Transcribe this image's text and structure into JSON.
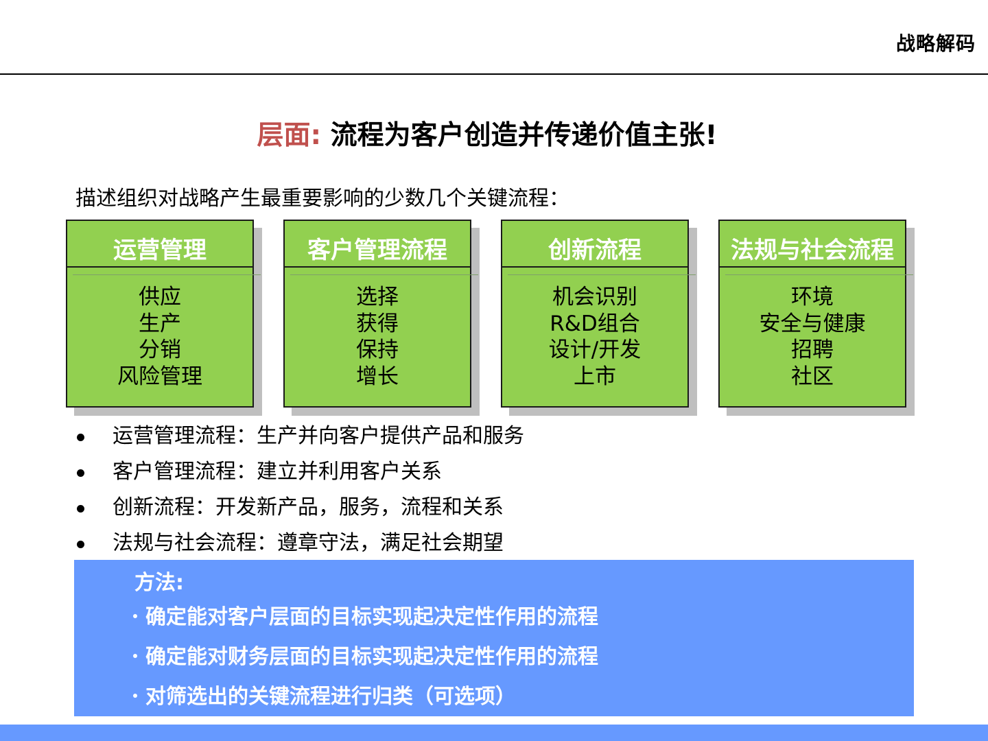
{
  "header": {
    "brand": "战略解码"
  },
  "title": {
    "prefix": "层面:",
    "main": " 流程为客户创造并传递价值主张!"
  },
  "subtitle": "描述组织对战略产生最重要影响的少数几个关键流程：",
  "boxes": [
    {
      "header": "运营管理",
      "items": [
        "供应",
        "生产",
        "分销",
        "风险管理"
      ]
    },
    {
      "header": "客户管理流程",
      "items": [
        "选择",
        "获得",
        "保持",
        "增长"
      ]
    },
    {
      "header": "创新流程",
      "items": [
        "机会识别",
        "R&D组合",
        "设计/开发",
        "上市"
      ]
    },
    {
      "header": "法规与社会流程",
      "items": [
        "环境",
        "安全与健康",
        "招聘",
        "社区"
      ]
    }
  ],
  "bullets": [
    "运营管理流程：生产并向客户提供产品和服务",
    "客户管理流程：建立并利用客户关系",
    "创新流程：开发新产品，服务，流程和关系",
    "法规与社会流程：遵章守法，满足社会期望"
  ],
  "method": {
    "title": "方法:",
    "items": [
      "确定能对客户层面的目标实现起决定性作用的流程",
      "确定能对财务层面的目标实现起决定性作用的流程",
      "对筛选出的关键流程进行归类（可选项）"
    ]
  },
  "colors": {
    "box_fill": "#92d050",
    "accent_red": "#c0504d",
    "method_blue": "#6699ff"
  }
}
